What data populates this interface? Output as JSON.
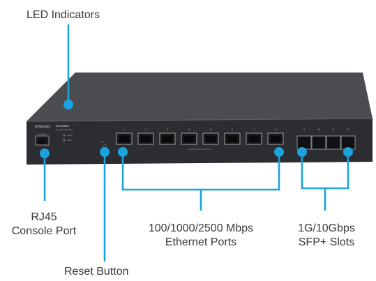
{
  "colors": {
    "callout": "#1aa3dc",
    "chassis_top": "#4a4c50",
    "chassis_front": "#2b2d31",
    "text": "#3a3a3a"
  },
  "device": {
    "brand": "EnGenius",
    "model": "ECS5512",
    "model_subtitle": "10G Managed Switch",
    "led_labels": [
      "Power",
      "Status"
    ],
    "port_caption": "100/1000/2500 Mbps Ports",
    "port_numbers": [
      "1",
      "2",
      "3",
      "4",
      "5",
      "6",
      "7",
      "8"
    ],
    "sfp_numbers": [
      "9",
      "10",
      "11",
      "12"
    ],
    "console_label": "Console",
    "reset_label": "Reset"
  },
  "labels": {
    "led_indicators": "LED Indicators",
    "rj45_line1": "RJ45",
    "rj45_line2": "Console Port",
    "ethernet_line1": "100/1000/2500 Mbps",
    "ethernet_line2": "Ethernet Ports",
    "sfp_line1": "1G/10Gbps",
    "sfp_line2": "SFP+ Slots",
    "reset_button": "Reset Button"
  }
}
